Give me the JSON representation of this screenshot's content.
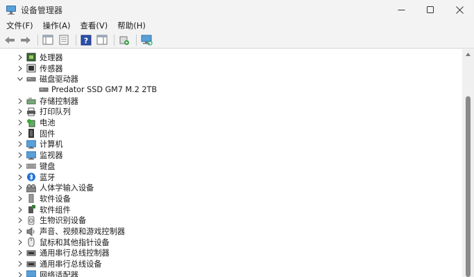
{
  "window": {
    "title": "设备管理器",
    "icon": "device-manager-icon"
  },
  "menu": {
    "items": [
      "文件(F)",
      "操作(A)",
      "查看(V)",
      "帮助(H)"
    ]
  },
  "toolbar": {
    "buttons": [
      "back-icon",
      "forward-icon",
      "show-hide-console-tree-icon",
      "properties-icon",
      "help-icon",
      "action-pane-icon",
      "update-driver-icon",
      "scan-hardware-icon"
    ]
  },
  "tree": {
    "items": [
      {
        "label": "处理器",
        "expanded": false,
        "icon": "processor-icon"
      },
      {
        "label": "传感器",
        "expanded": false,
        "icon": "sensor-icon"
      },
      {
        "label": "磁盘驱动器",
        "expanded": true,
        "icon": "disk-drive-icon"
      },
      {
        "label": "Predator SSD GM7 M.2 2TB",
        "child": true,
        "icon": "disk-drive-icon"
      },
      {
        "label": "存储控制器",
        "expanded": false,
        "icon": "storage-controller-icon"
      },
      {
        "label": "打印队列",
        "expanded": false,
        "icon": "printer-icon"
      },
      {
        "label": "电池",
        "expanded": false,
        "icon": "battery-icon"
      },
      {
        "label": "固件",
        "expanded": false,
        "icon": "firmware-icon"
      },
      {
        "label": "计算机",
        "expanded": false,
        "icon": "computer-icon"
      },
      {
        "label": "监视器",
        "expanded": false,
        "icon": "monitor-icon"
      },
      {
        "label": "键盘",
        "expanded": false,
        "icon": "keyboard-icon"
      },
      {
        "label": "蓝牙",
        "expanded": false,
        "icon": "bluetooth-icon"
      },
      {
        "label": "人体学输入设备",
        "expanded": false,
        "icon": "hid-icon"
      },
      {
        "label": "软件设备",
        "expanded": false,
        "icon": "software-device-icon"
      },
      {
        "label": "软件组件",
        "expanded": false,
        "icon": "software-component-icon"
      },
      {
        "label": "生物识别设备",
        "expanded": false,
        "icon": "biometric-icon"
      },
      {
        "label": "声音、视频和游戏控制器",
        "expanded": false,
        "icon": "sound-icon"
      },
      {
        "label": "鼠标和其他指针设备",
        "expanded": false,
        "icon": "mouse-icon"
      },
      {
        "label": "通用串行总线控制器",
        "expanded": false,
        "icon": "usb-icon"
      },
      {
        "label": "通用串行总线设备",
        "expanded": false,
        "icon": "usb-icon"
      },
      {
        "label": "网络适配器",
        "expanded": false,
        "icon": "network-adapter-icon"
      }
    ]
  }
}
